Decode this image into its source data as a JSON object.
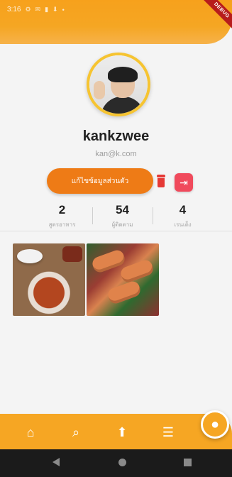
{
  "status_bar": {
    "time": "3:16",
    "icons": [
      "settings-icon",
      "message-icon",
      "sim-icon",
      "download-icon",
      "dot-icon"
    ]
  },
  "debug_banner": "DEBUG",
  "profile": {
    "username": "kankzwee",
    "email": "kan@k.com",
    "edit_label": "แก้ไขข้อมูลส่วนตัว"
  },
  "stats": [
    {
      "value": "2",
      "label": "สูตรอาหาร"
    },
    {
      "value": "54",
      "label": "ผู้ติดตาม"
    },
    {
      "value": "4",
      "label": "เรนเด็ง"
    }
  ],
  "bottom_nav": {
    "home_icon": "⌂",
    "search_icon": "⌕",
    "upload_icon": "⬆",
    "list_icon": "☰",
    "profile_icon": "●"
  },
  "colors": {
    "accent": "#f6a623",
    "edit_button": "#ee7b16",
    "logout": "#f04a5c",
    "trash": "#e53935",
    "avatar_ring": "#f6c431"
  }
}
